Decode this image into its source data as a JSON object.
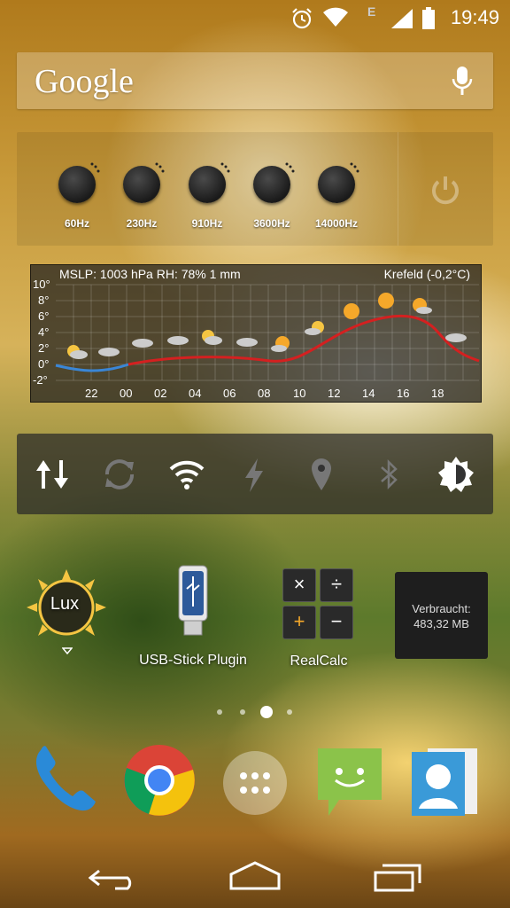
{
  "status_bar": {
    "time": "19:49",
    "network": "E"
  },
  "google_bar": {
    "logo": "Google"
  },
  "equalizer": {
    "bands": [
      "60Hz",
      "230Hz",
      "910Hz",
      "3600Hz",
      "14000Hz"
    ]
  },
  "weather": {
    "header": "MSLP: 1003 hPa  RH: 78%  1 mm",
    "location": "Krefeld (-0,2°C)",
    "y_ticks": [
      "10°",
      "8°",
      "6°",
      "4°",
      "2°",
      "0°",
      "-2°"
    ],
    "x_ticks": [
      "22",
      "00",
      "02",
      "04",
      "06",
      "08",
      "10",
      "12",
      "14",
      "16",
      "18"
    ]
  },
  "apps": {
    "lux_label": "Lux",
    "usb_label": "USB-Stick Plugin",
    "calc_label": "RealCalc",
    "calc_keys": [
      "×",
      "÷",
      "+",
      "−"
    ],
    "usage_label": "Verbraucht:",
    "usage_value": "483,32 MB"
  },
  "colors": {
    "accent_blue": "#3a86d6",
    "accent_red": "#d42020"
  }
}
